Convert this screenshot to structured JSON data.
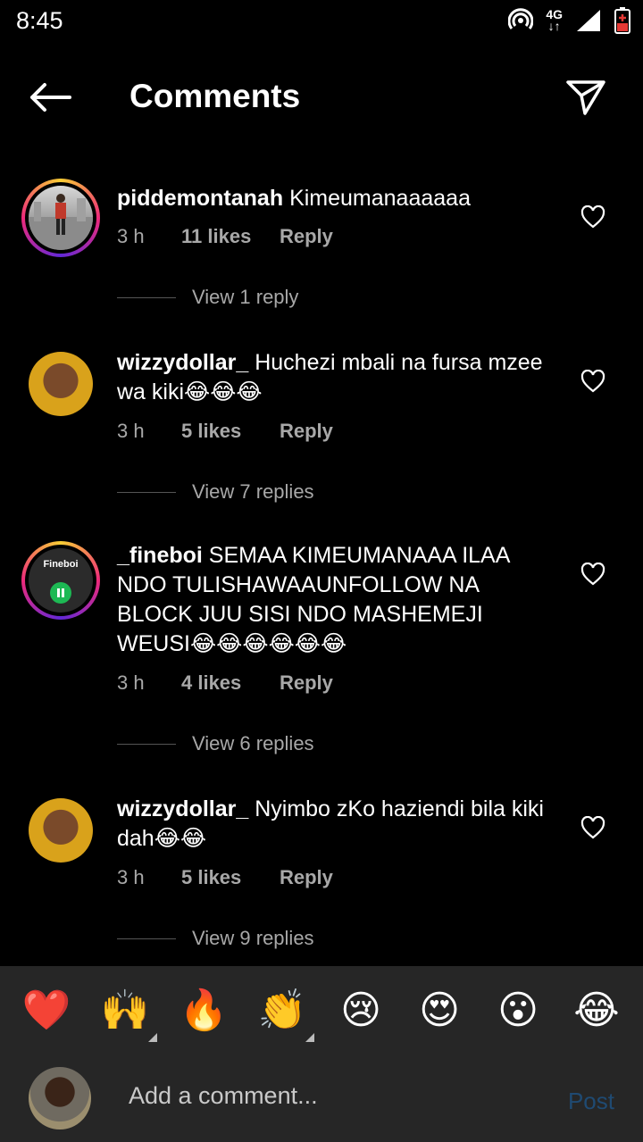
{
  "status": {
    "time": "8:45",
    "network": "4G"
  },
  "header": {
    "title": "Comments"
  },
  "comments": [
    {
      "username": "piddemontanah",
      "text": "Kimeumanaaaaaa",
      "time": "3 h",
      "likes": "11 likes",
      "reply": "Reply",
      "view_replies": "View 1 reply"
    },
    {
      "username": "wizzydollar_",
      "text": "Huchezi mbali na fursa mzee wa kiki😂😂😂",
      "time": "3 h",
      "likes": "5 likes",
      "reply": "Reply",
      "view_replies": "View 7 replies"
    },
    {
      "username": "_fineboi",
      "text": "SEMAA KIMEUMANAAA ILAA NDO TULISHAWAAUNFOLLOW NA BLOCK JUU SISI NDO MASHEMEJI WEUSI😂😂😂😂😂😂",
      "time": "3 h",
      "likes": "4 likes",
      "reply": "Reply",
      "view_replies": "View 6 replies",
      "avatar_label": "Fineboi"
    },
    {
      "username": "wizzydollar_",
      "text": "Nyimbo zKo haziendi bila kiki dah😂😂",
      "time": "3 h",
      "likes": "5 likes",
      "reply": "Reply",
      "view_replies": "View 9 replies"
    }
  ],
  "emoji_bar": [
    "❤️",
    "🙌",
    "🔥",
    "👏",
    "😢",
    "😍",
    "😮",
    "😂"
  ],
  "composer": {
    "placeholder": "Add a comment...",
    "post_label": "Post"
  },
  "colors": {
    "background": "#000000",
    "bar": "#262626",
    "muted": "#a8a8a8",
    "post_disabled": "#1f4a72"
  }
}
